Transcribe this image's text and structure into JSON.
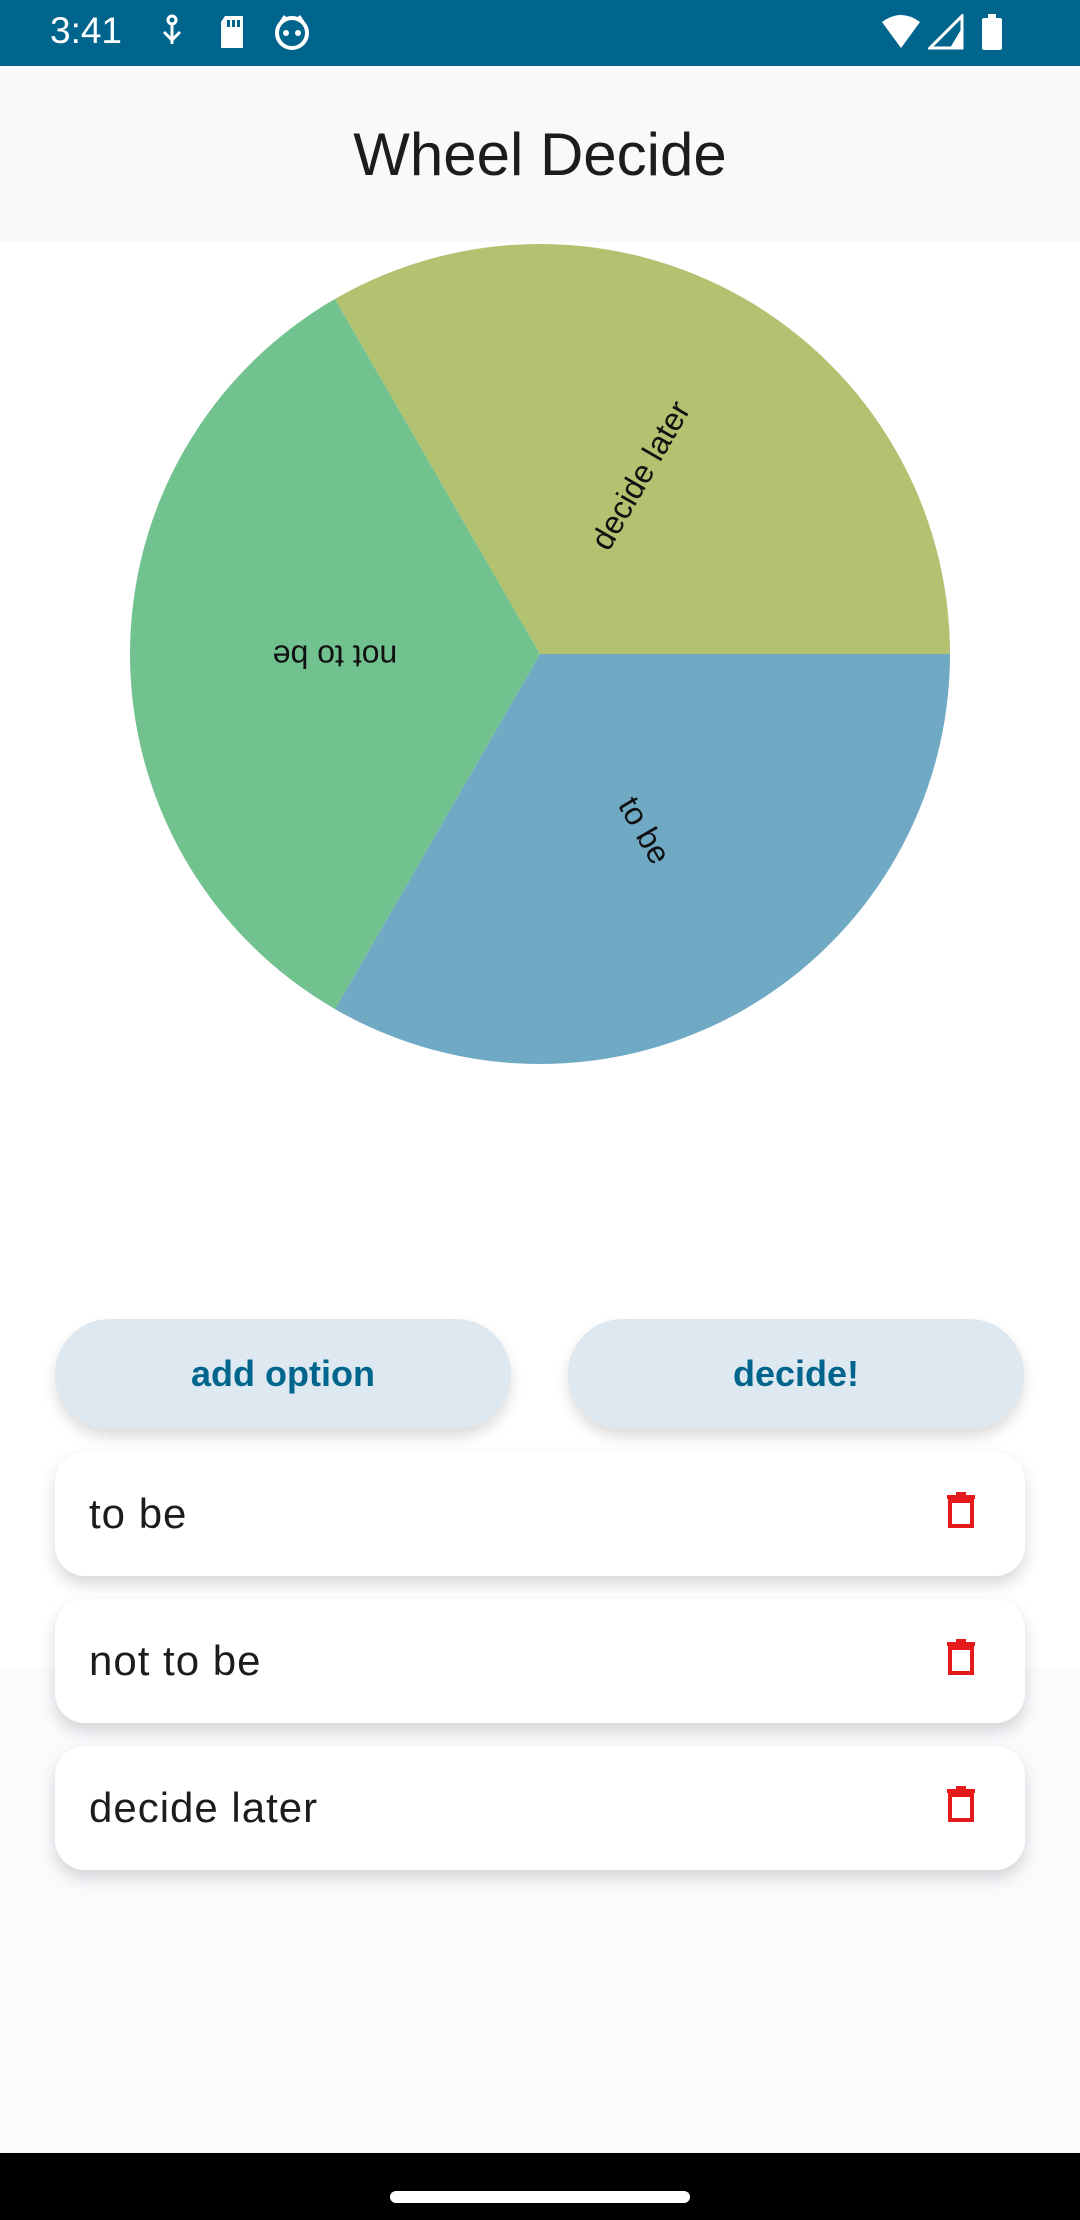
{
  "status_bar": {
    "time": "3:41",
    "left_icons": [
      "usb-icon",
      "sd-card-icon",
      "bug-icon"
    ],
    "right_icons": [
      "wifi-icon",
      "signal-icon",
      "battery-icon"
    ]
  },
  "app": {
    "title": "Wheel Decide"
  },
  "wheel": {
    "segments": [
      {
        "label": "to be",
        "color": "#70a9c4"
      },
      {
        "label": "not to be",
        "color": "#72c28f"
      },
      {
        "label": "decide later",
        "color": "#b2c270"
      }
    ]
  },
  "buttons": {
    "add_option": "add option",
    "decide": "decide!"
  },
  "options": [
    {
      "label": "to be"
    },
    {
      "label": "not to be"
    },
    {
      "label": "decide later"
    }
  ],
  "colors": {
    "status_bar": "#00658c",
    "accent": "#00658c",
    "button_bg": "#dde8f1",
    "delete_icon": "#e51b1b"
  }
}
